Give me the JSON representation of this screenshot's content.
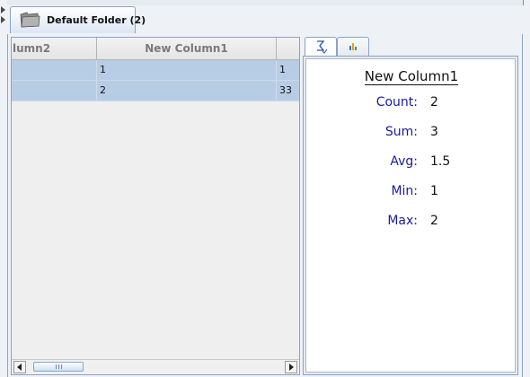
{
  "tab": {
    "label": "Default Folder (2)",
    "icon": "folder-icon"
  },
  "table": {
    "columns": [
      "lumn2",
      "New Column1",
      ""
    ],
    "rows": [
      [
        "",
        "1",
        "1"
      ],
      [
        "",
        "2",
        "33"
      ]
    ]
  },
  "stats": {
    "tab_icons": [
      "summary-stats-icon",
      "bar-chart-icon"
    ],
    "title": "New Column1",
    "rows": [
      {
        "label": "Count:",
        "value": "2"
      },
      {
        "label": "Sum:",
        "value": "3"
      },
      {
        "label": "Avg:",
        "value": "1.5"
      },
      {
        "label": "Min:",
        "value": "1"
      },
      {
        "label": "Max:",
        "value": "2"
      }
    ]
  },
  "colors": {
    "selected_row": "#b7cde6",
    "label_blue": "#1a1aa6",
    "panel_border": "#8ca2c4"
  }
}
